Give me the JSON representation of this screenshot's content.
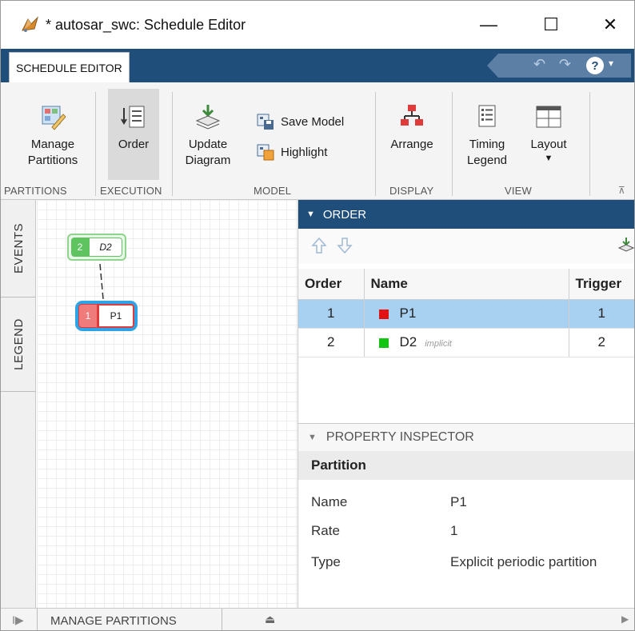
{
  "window": {
    "title": "* autosar_swc: Schedule Editor",
    "minimize_glyph": "—",
    "maximize_glyph": "☐",
    "close_glyph": "✕"
  },
  "tabs": {
    "active": "SCHEDULE EDITOR"
  },
  "quick_access": {
    "undo": "↶",
    "redo": "↷",
    "help": "?",
    "help_caret": "▾"
  },
  "toolstrip": {
    "manage_partitions": "Manage Partitions",
    "order": "Order",
    "update_diagram": "Update Diagram",
    "save_model": "Save Model",
    "highlight": "Highlight",
    "arrange": "Arrange",
    "timing_legend": "Timing Legend",
    "layout": "Layout",
    "layout_caret": "▼",
    "sections": {
      "partitions": "PARTITIONS",
      "execution": "EXECUTION",
      "model": "MODEL",
      "display": "DISPLAY",
      "view": "VIEW"
    },
    "collapse_glyph": "⊼"
  },
  "side_tabs": {
    "events": "EVENTS",
    "legend": "LEGEND"
  },
  "canvas": {
    "nodes": [
      {
        "order": "2",
        "name": "D2",
        "color": "#5fc45f"
      },
      {
        "order": "1",
        "name": "P1",
        "color": "#e03a3a"
      }
    ]
  },
  "order_panel": {
    "header": "ORDER",
    "caret": "▼",
    "columns": [
      "Order",
      "Name",
      "Trigger"
    ],
    "rows": [
      {
        "order": "1",
        "name": "P1",
        "note": "",
        "trigger": "1",
        "color": "#e21212",
        "selected": true
      },
      {
        "order": "2",
        "name": "D2",
        "note": "implicit",
        "trigger": "2",
        "color": "#14c414",
        "selected": false
      }
    ]
  },
  "inspector": {
    "header": "PROPERTY INSPECTOR",
    "caret": "▼",
    "section": "Partition",
    "props": [
      {
        "key": "Name",
        "value": "P1"
      },
      {
        "key": "Rate",
        "value": "1"
      },
      {
        "key": "Type",
        "value": "Explicit periodic partition"
      }
    ]
  },
  "bottom": {
    "manage_partitions": "MANAGE PARTITIONS",
    "expand_glyph": "I▶",
    "eject_glyph": "⏏",
    "scroll_glyph": "▶"
  }
}
